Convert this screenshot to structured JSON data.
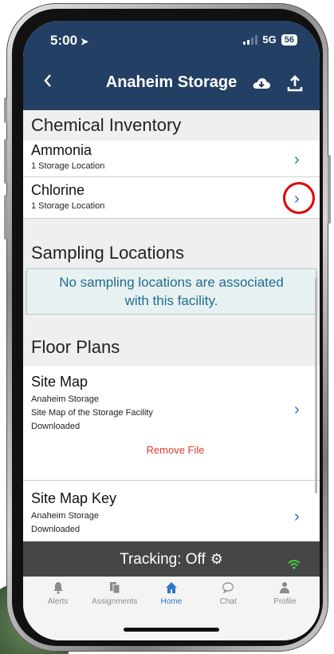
{
  "status": {
    "time": "5:00",
    "network": "5G",
    "battery": "56"
  },
  "header": {
    "title": "Anaheim Storage"
  },
  "chemical_inventory": {
    "title": "Chemical Inventory",
    "items": [
      {
        "name": "Ammonia",
        "detail": "1 Storage Location"
      },
      {
        "name": "Chlorine",
        "detail": "1 Storage Location"
      }
    ]
  },
  "sampling_locations": {
    "title": "Sampling Locations",
    "notice_line1": "No sampling locations are associated",
    "notice_line2": "with this facility."
  },
  "floor_plans": {
    "title": "Floor Plans",
    "items": [
      {
        "name": "Site Map",
        "line1": "Anaheim Storage",
        "line2": "Site Map of the Storage Facility",
        "line3": "Downloaded",
        "action": "Remove File"
      },
      {
        "name": "Site Map Key",
        "line1": "Anaheim Storage",
        "line2": "Downloaded"
      }
    ]
  },
  "tracking": {
    "label": "Tracking:",
    "value": "Off"
  },
  "tabs": [
    {
      "label": "Alerts",
      "icon": "bell-icon"
    },
    {
      "label": "Assignments",
      "icon": "documents-icon"
    },
    {
      "label": "Home",
      "icon": "home-icon"
    },
    {
      "label": "Chat",
      "icon": "chat-bubble-icon"
    },
    {
      "label": "Profile",
      "icon": "person-icon"
    }
  ],
  "colors": {
    "header": "#233f63",
    "accent": "#2c6fc0",
    "danger": "#e03a2e",
    "highlight": "#e00000",
    "tracking_bar": "#464646"
  }
}
